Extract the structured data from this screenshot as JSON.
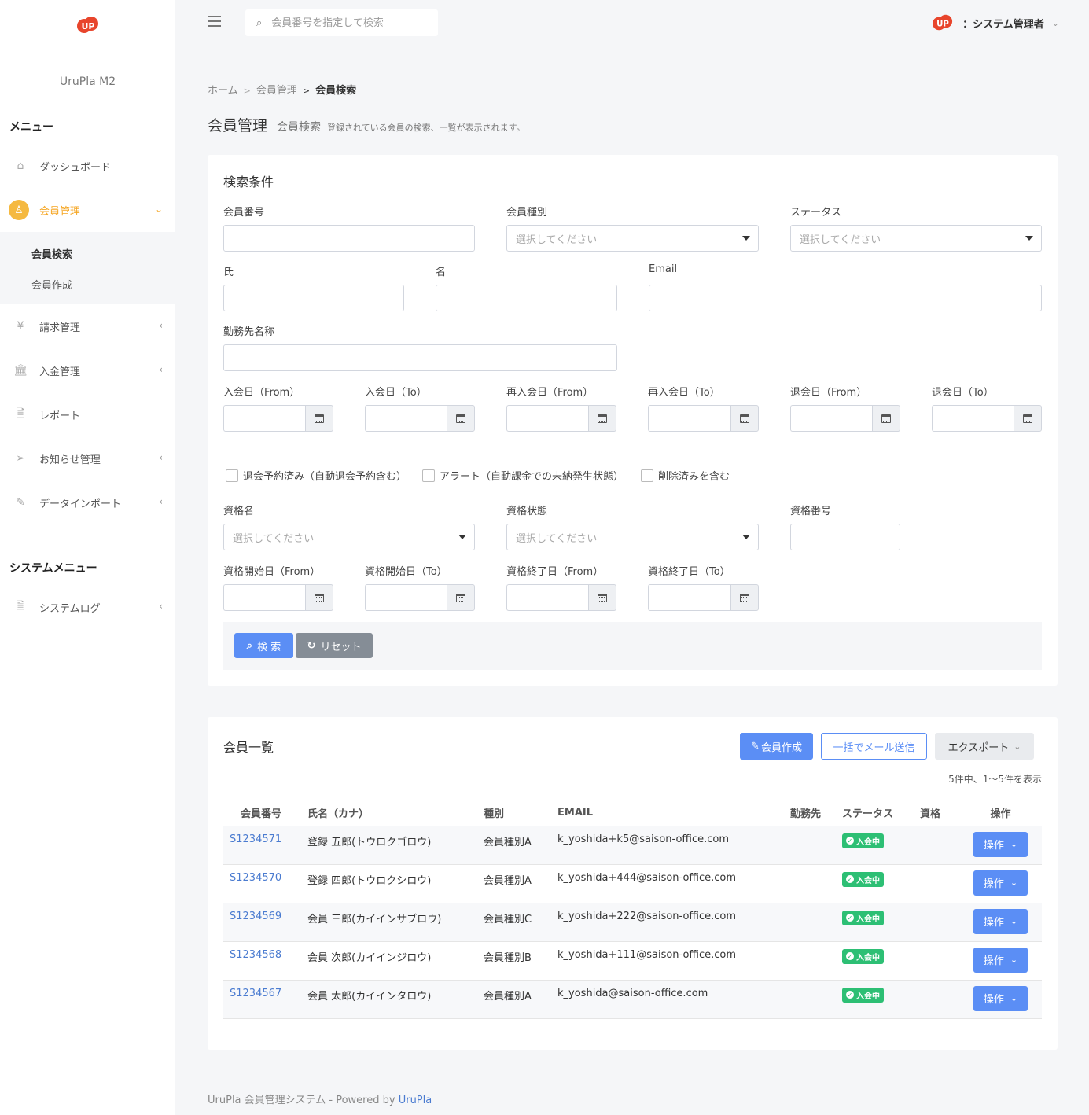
{
  "sidebar": {
    "brand": "UruPla M2",
    "menu_heading": "メニュー",
    "items": [
      {
        "label": "ダッシュボード",
        "icon": "home-icon"
      },
      {
        "label": "会員管理",
        "icon": "user-icon"
      },
      {
        "label": "請求管理",
        "icon": "yen-icon"
      },
      {
        "label": "入金管理",
        "icon": "bank-icon"
      },
      {
        "label": "レポート",
        "icon": "document-icon"
      },
      {
        "label": "お知らせ管理",
        "icon": "paper-plane-icon"
      },
      {
        "label": "データインポート",
        "icon": "edit-icon"
      }
    ],
    "submenu": [
      "会員検索",
      "会員作成"
    ],
    "system_heading": "システムメニュー",
    "system_items": [
      {
        "label": "システムログ",
        "icon": "document-icon"
      }
    ]
  },
  "topbar": {
    "search_placeholder": "会員番号を指定して検索",
    "user_label": "：システム管理者"
  },
  "breadcrumb": [
    "ホーム",
    "会員管理",
    "会員検索"
  ],
  "page": {
    "title": "会員管理",
    "subtitle": "会員検索",
    "description": "登録されている会員の検索、一覧が表示されます。"
  },
  "search": {
    "title": "検索条件",
    "member_no": "会員番号",
    "member_type": "会員種別",
    "status": "ステータス",
    "select_placeholder": "選択してください",
    "last_name": "氏",
    "first_name": "名",
    "email": "Email",
    "company": "勤務先名称",
    "join_from": "入会日（From）",
    "join_to": "入会日（To）",
    "rejoin_from": "再入会日（From）",
    "rejoin_to": "再入会日（To）",
    "leave_from": "退会日（From）",
    "leave_to": "退会日（To）",
    "chk_leave": "退会予約済み（自動退会予約含む）",
    "chk_alert": "アラート（自動課金での未納発生状態）",
    "chk_deleted": "削除済みを含む",
    "qual_name": "資格名",
    "qual_state": "資格状態",
    "qual_no": "資格番号",
    "qual_start_from": "資格開始日（From）",
    "qual_start_to": "資格開始日（To）",
    "qual_end_from": "資格終了日（From）",
    "qual_end_to": "資格終了日（To）",
    "search_btn": "検 索",
    "reset_btn": "リセット"
  },
  "list": {
    "title": "会員一覧",
    "create_btn": "会員作成",
    "mail_btn": "一括でメール送信",
    "export_btn": "エクスポート",
    "count_text": "5件中、1〜5件を表示",
    "headers": [
      "会員番号",
      "氏名（カナ）",
      "種別",
      "EMAIL",
      "勤務先",
      "ステータス",
      "資格",
      "操作"
    ],
    "rows": [
      {
        "id": "S1234571",
        "name": "登録 五郎(トウロクゴロウ)",
        "type": "会員種別A",
        "email": "k_yoshida+k5@saison-office.com",
        "company": "",
        "status": "入会中",
        "qual": "",
        "op": "操作"
      },
      {
        "id": "S1234570",
        "name": "登録 四郎(トウロクシロウ)",
        "type": "会員種別A",
        "email": "k_yoshida+444@saison-office.com",
        "company": "",
        "status": "入会中",
        "qual": "",
        "op": "操作"
      },
      {
        "id": "S1234569",
        "name": "会員 三郎(カイインサブロウ)",
        "type": "会員種別C",
        "email": "k_yoshida+222@saison-office.com",
        "company": "",
        "status": "入会中",
        "qual": "",
        "op": "操作"
      },
      {
        "id": "S1234568",
        "name": "会員 次郎(カイインジロウ)",
        "type": "会員種別B",
        "email": "k_yoshida+111@saison-office.com",
        "company": "",
        "status": "入会中",
        "qual": "",
        "op": "操作"
      },
      {
        "id": "S1234567",
        "name": "会員 太郎(カイインタロウ)",
        "type": "会員種別A",
        "email": "k_yoshida@saison-office.com",
        "company": "",
        "status": "入会中",
        "qual": "",
        "op": "操作"
      }
    ]
  },
  "footer": {
    "text": "UruPla 会員管理システム - Powered by ",
    "link": "UruPla"
  },
  "colors": {
    "accent": "#5b8ef5",
    "active": "#f5a623",
    "status_green": "#2dbf74",
    "logo_red": "#e8452c"
  }
}
